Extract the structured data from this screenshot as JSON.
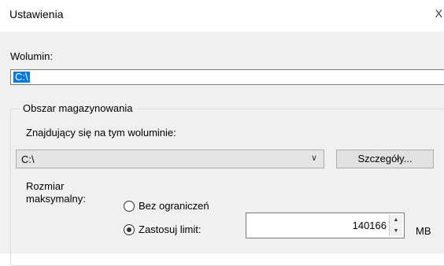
{
  "window": {
    "title": "Ustawienia",
    "close_glyph": "X"
  },
  "volume": {
    "label": "Wolumin:",
    "value": "C:\\"
  },
  "storage": {
    "group_title": "Obszar magazynowania",
    "location_label": "Znajdujący się na tym woluminie:",
    "location_value": "C:\\",
    "details_button": "Szczegóły...",
    "max_size_label_line1": "Rozmiar",
    "max_size_label_line2": "maksymalny:",
    "option_unlimited": "Bez ograniczeń",
    "option_limit": "Zastosuj limit:",
    "selected_option": "limit",
    "limit_value": "140166",
    "unit": "MB"
  },
  "icons": {
    "dropdown": "chevron-down-icon",
    "spin_up": "spin-up-icon",
    "spin_down": "spin-down-icon"
  }
}
